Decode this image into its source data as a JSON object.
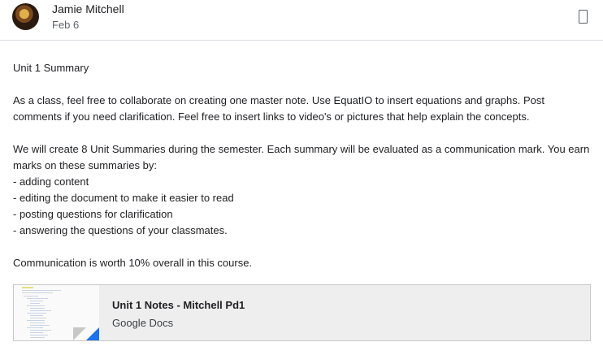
{
  "post_header": {
    "author": "Jamie Mitchell",
    "date": "Feb 6",
    "bookmark_icon": "bookmark-icon"
  },
  "post_body": {
    "title": "Unit 1 Summary",
    "paragraph1_line1": "As a class, feel free to collaborate on creating one master note. Use EquatIO to insert equations and graphs. Post",
    "paragraph1_line2": "comments if you need clarification. Feel free to insert links to video's or pictures that help explain the concepts.",
    "paragraph2_line1": "We will create 8 Unit Summaries during the semester. Each summary will be evaluated as a communication mark. You earn",
    "paragraph2_line2": "marks on these summaries by:",
    "bullets": [
      "- adding content",
      "- editing the document to make it easier to read",
      "- posting questions for clarification",
      "- answering the questions of your classmates."
    ],
    "closing": "Communication is worth 10% overall in this course."
  },
  "attachment": {
    "title": "Unit 1 Notes - Mitchell Pd1",
    "type": "Google Docs",
    "icon": "google-docs-icon"
  }
}
